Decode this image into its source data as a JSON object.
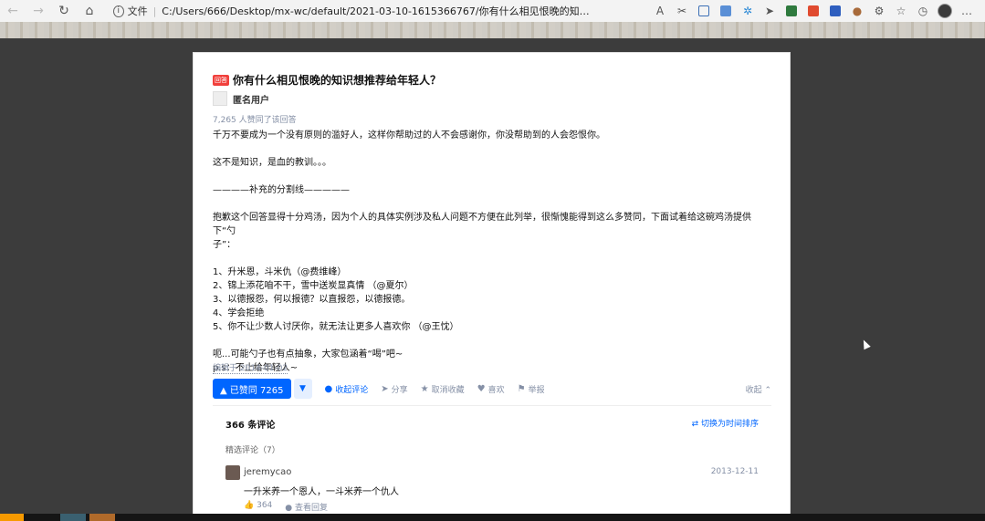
{
  "browser": {
    "file_label": "文件",
    "url": "C:/Users/666/Desktop/mx-wc/default/2021-03-10-1615366767/你有什么相见恨晚的知识想推荐给年轻..."
  },
  "question": {
    "badge": "回答",
    "title": "你有什么相见恨晚的知识想推荐给年轻人？"
  },
  "answer": {
    "author": "匿名用户",
    "vote_line": "7,265 人赞同了该回答",
    "body": [
      "千万不要成为一个没有原则的滥好人，这样你帮助过的人不会感谢你，你没帮助到的人会怨恨你。",
      "",
      "这不是知识，是血的教训。。。",
      "",
      "————补充的分割线—————",
      "",
      "抱歉这个回答显得十分鸡汤，因为个人的具体实例涉及私人问题不方便在此列举，很惭愧能得到这么多赞同，下面试着给这碗鸡汤提供下“勺",
      "子”：",
      "",
      "1、升米恩，斗米仇（@费维峰）",
      "2、锦上添花咱不干，雪中送炭显真情 （@夏尔）",
      "3、以德报怨，何以报德？以直报怨，以德报德。",
      "4、学会拒绝",
      "5、你不让少数人讨厌你，就无法让更多人喜欢你 （@王忱）",
      "",
      "呃...可能勺子也有点抽象，大家包涵着“喝”吧~",
      "p.s：不止给年轻人~"
    ],
    "edited": "编辑于 2014-01-02"
  },
  "actions": {
    "vote_label": "▲ 已赞同 7265",
    "vote_down": "▼",
    "collapse_comments": "收起评论",
    "share": "分享",
    "unfavorite": "取消收藏",
    "like": "喜欢",
    "report": "举报",
    "collapse": "收起 ⌃"
  },
  "comments": {
    "count_label": "366 条评论",
    "sort_label": "⇄ 切换为时间排序",
    "featured_label": "精选评论（7）",
    "items": [
      {
        "user": "jeremycao",
        "date": "2013-12-11",
        "text": "一升米养一个恩人，一斗米养一个仇人",
        "likes": "364",
        "reply": "查看回复"
      }
    ]
  }
}
